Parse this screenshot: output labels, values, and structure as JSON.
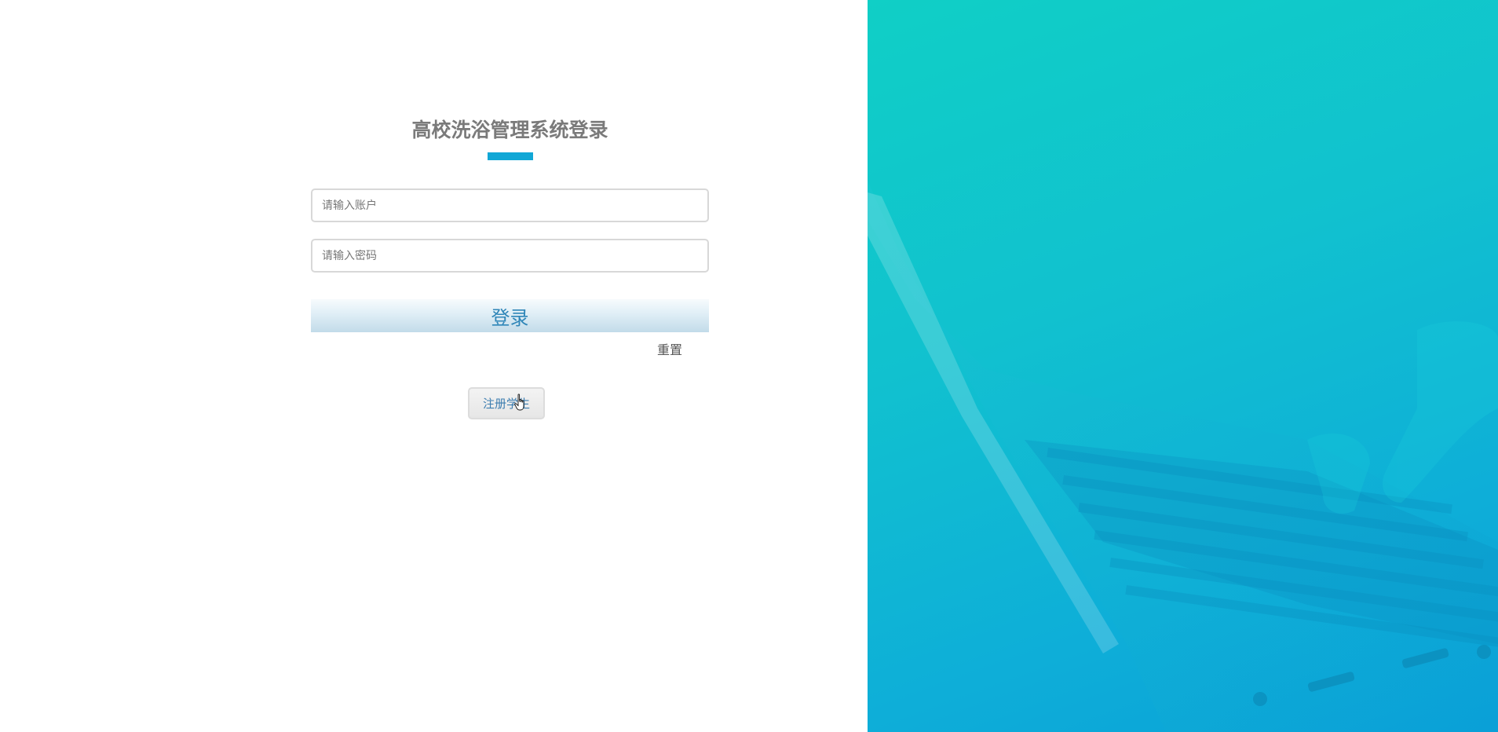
{
  "login": {
    "title": "高校洗浴管理系统登录",
    "account_placeholder": "请输入账户",
    "password_placeholder": "请输入密码",
    "login_label": "登录",
    "reset_label": "重置",
    "register_label": "注册学生"
  },
  "colors": {
    "accent": "#11a7d6",
    "panel_gradient_start": "#10cfc6",
    "panel_gradient_end": "#0aa0d9"
  },
  "icons": {
    "cursor": "hand-pointer-icon"
  }
}
